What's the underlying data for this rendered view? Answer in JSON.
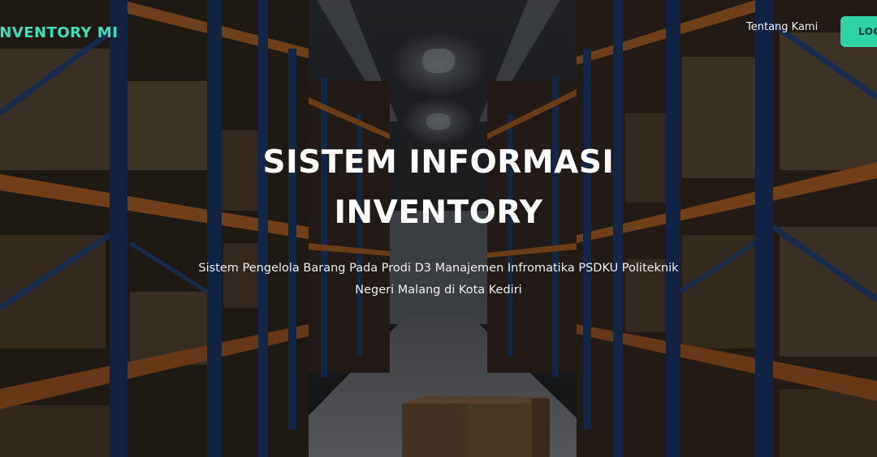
{
  "nav": {
    "brand": "INVENTORY MI",
    "about_link": "Tentang Kami",
    "login_label": "LOGIN"
  },
  "hero": {
    "title_line1": "SISTEM INFORMASI",
    "title_line2": "INVENTORY",
    "subtitle": "Sistem Pengelola Barang Pada Prodi D3 Manajemen Infromatika PSDKU Politeknik Negeri Malang di Kota Kediri"
  },
  "colors": {
    "accent": "#2fd3a4",
    "brand_text": "#3fe0b5"
  },
  "background": {
    "scene": "warehouse-shelves-photo"
  }
}
